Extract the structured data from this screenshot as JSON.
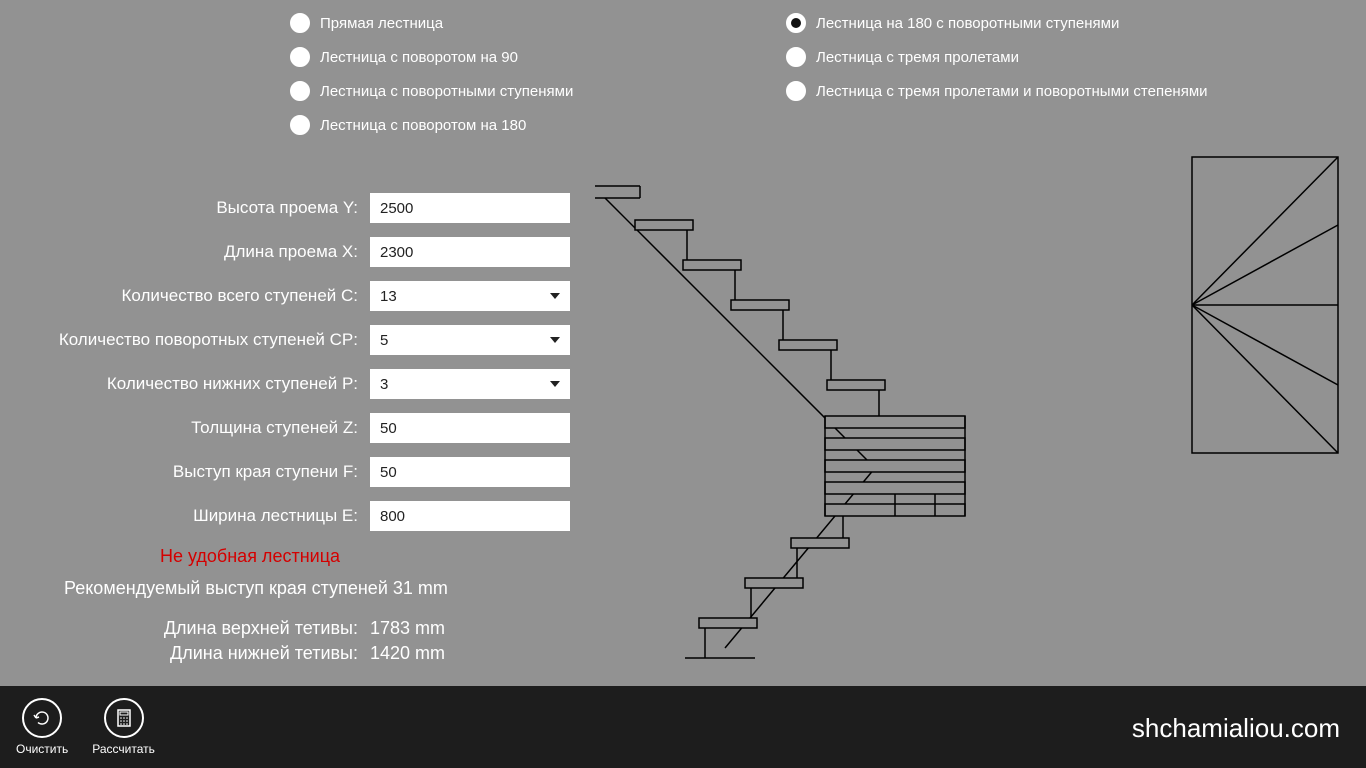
{
  "radios": {
    "col1": [
      {
        "label": "Прямая лестница",
        "selected": false
      },
      {
        "label": "Лестница с поворотом на 90",
        "selected": false
      },
      {
        "label": "Лестница с поворотными ступенями",
        "selected": false
      },
      {
        "label": "Лестница с поворотом на 180",
        "selected": false
      }
    ],
    "col2": [
      {
        "label": "Лестница на 180 с поворотными ступенями",
        "selected": true
      },
      {
        "label": "Лестница с тремя пролетами",
        "selected": false
      },
      {
        "label": "Лестница с тремя пролетами и поворотными степенями",
        "selected": false
      }
    ]
  },
  "form": {
    "heightY": {
      "label": "Высота проема Y:",
      "value": "2500"
    },
    "lengthX": {
      "label": "Длина проема X:",
      "value": "2300"
    },
    "stepsC": {
      "label": "Количество всего ступеней C:",
      "value": "13"
    },
    "turnCP": {
      "label": "Количество поворотных ступеней CP:",
      "value": "5"
    },
    "lowerP": {
      "label": "Количество нижних ступеней P:",
      "value": "3"
    },
    "thickZ": {
      "label": "Толщина ступеней Z:",
      "value": "50"
    },
    "noseF": {
      "label": "Выступ края ступени F:",
      "value": "50"
    },
    "widthE": {
      "label": "Ширина лестницы E:",
      "value": "800"
    }
  },
  "warning": "Не удобная лестница",
  "recommend": "Рекомендуемый выступ края ступеней 31 mm",
  "results": {
    "upper": {
      "label": "Длина верхней тетивы:",
      "value": "1783 mm"
    },
    "lower": {
      "label": "Длина нижней тетивы:",
      "value": "1420 mm"
    }
  },
  "bottomBar": {
    "clear": "Очистить",
    "calc": "Рассчитать"
  },
  "brand": "shchamialiou.com"
}
